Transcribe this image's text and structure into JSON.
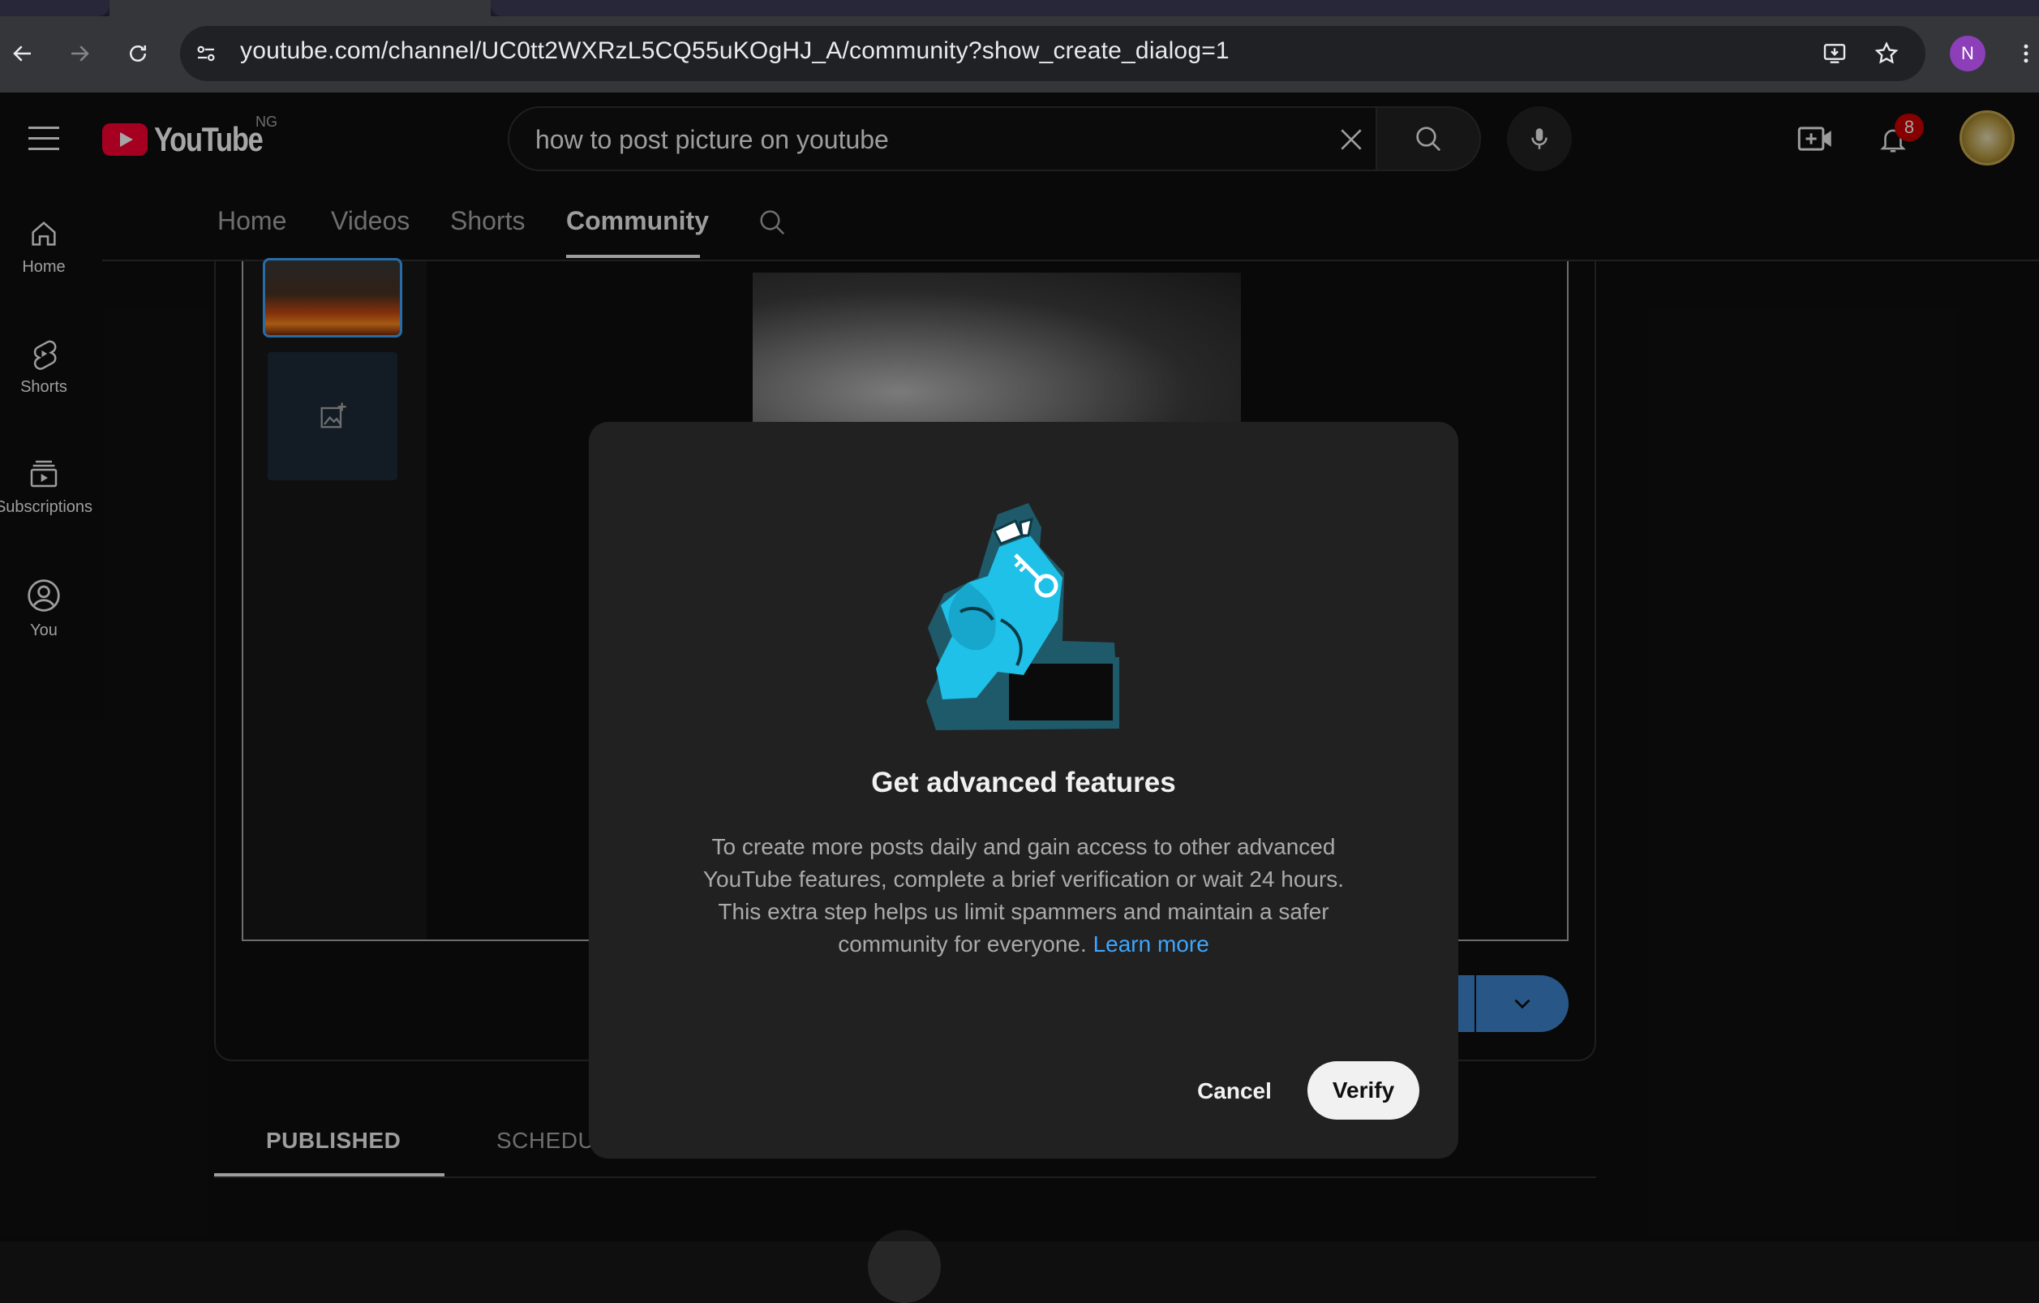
{
  "browser": {
    "url": "youtube.com/channel/UC0tt2WXRzL5CQ55uKOgHJ_A/community?show_create_dialog=1",
    "profile_initial": "N"
  },
  "header": {
    "logo_text": "YouTube",
    "country_code": "NG",
    "search_value": "how to post picture on youtube",
    "notification_count": "8"
  },
  "sidebar": {
    "items": [
      {
        "label": "Home",
        "icon": "home-icon"
      },
      {
        "label": "Shorts",
        "icon": "shorts-icon"
      },
      {
        "label": "Subscriptions",
        "icon": "subscriptions-icon"
      },
      {
        "label": "You",
        "icon": "you-icon"
      }
    ]
  },
  "channel_tabs": {
    "items": [
      "Home",
      "Videos",
      "Shorts",
      "Community"
    ],
    "active": "Community"
  },
  "post_tabs": {
    "published": "PUBLISHED",
    "scheduled": "SCHEDU"
  },
  "dialog": {
    "title": "Get advanced features",
    "body": "To create more posts daily and gain access to other advanced YouTube features, complete a brief verification or wait 24 hours. This extra step helps us limit spammers and maintain a safer community for everyone.",
    "link": "Learn more",
    "cancel_label": "Cancel",
    "verify_label": "Verify"
  },
  "colors": {
    "accent_blue": "#3ea6ff",
    "brand_red": "#ff0033",
    "dialog_bg": "#212121",
    "illustration_cyan": "#1fc1e8"
  }
}
